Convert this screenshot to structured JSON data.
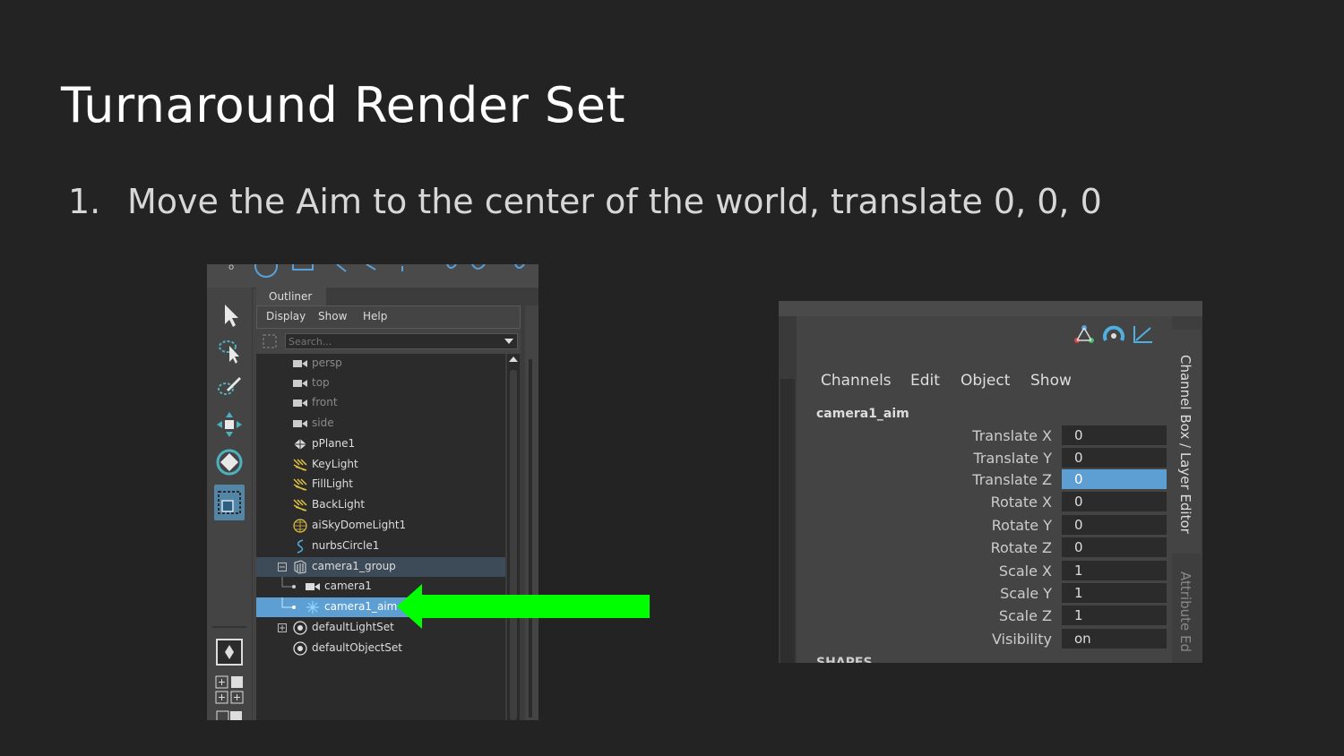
{
  "slide": {
    "title": "Turnaround Render Set",
    "step_number": "1.",
    "step_text": "Move the Aim to the center of the world, translate 0, 0, 0"
  },
  "outliner": {
    "panel_title": "Outliner",
    "menu": [
      "Display",
      "Show",
      "Help"
    ],
    "search_placeholder": "Search...",
    "items": [
      {
        "label": "persp",
        "icon": "camera-icon",
        "state": "dim"
      },
      {
        "label": "top",
        "icon": "camera-icon",
        "state": "dim"
      },
      {
        "label": "front",
        "icon": "camera-icon",
        "state": "dim"
      },
      {
        "label": "side",
        "icon": "camera-icon",
        "state": "dim"
      },
      {
        "label": "pPlane1",
        "icon": "mesh-icon",
        "state": "normal"
      },
      {
        "label": "KeyLight",
        "icon": "area-light-icon",
        "state": "normal"
      },
      {
        "label": "FillLight",
        "icon": "area-light-icon",
        "state": "normal"
      },
      {
        "label": "BackLight",
        "icon": "area-light-icon",
        "state": "normal"
      },
      {
        "label": "aiSkyDomeLight1",
        "icon": "sky-dome-icon",
        "state": "normal"
      },
      {
        "label": "nurbsCircle1",
        "icon": "curve-icon",
        "state": "normal"
      },
      {
        "label": "camera1_group",
        "icon": "group-icon",
        "state": "group",
        "expander": "minus"
      },
      {
        "label": "camera1",
        "icon": "camera-icon",
        "state": "child"
      },
      {
        "label": "camera1_aim",
        "icon": "locator-icon",
        "state": "selected"
      },
      {
        "label": "defaultLightSet",
        "icon": "set-icon",
        "state": "normal",
        "expander": "plus"
      },
      {
        "label": "defaultObjectSet",
        "icon": "set-icon",
        "state": "normal"
      }
    ],
    "pointer_color": "#00ff00"
  },
  "channel_box": {
    "menu": [
      "Channels",
      "Edit",
      "Object",
      "Show"
    ],
    "node_name": "camera1_aim",
    "attributes": [
      {
        "name": "Translate X",
        "value": "0"
      },
      {
        "name": "Translate Y",
        "value": "0"
      },
      {
        "name": "Translate Z",
        "value": "0",
        "highlight": true
      },
      {
        "name": "Rotate X",
        "value": "0"
      },
      {
        "name": "Rotate Y",
        "value": "0"
      },
      {
        "name": "Rotate Z",
        "value": "0"
      },
      {
        "name": "Scale X",
        "value": "1"
      },
      {
        "name": "Scale Y",
        "value": "1"
      },
      {
        "name": "Scale Z",
        "value": "1"
      },
      {
        "name": "Visibility",
        "value": "on"
      }
    ],
    "shapes_header": "SHAPES",
    "side_tab_active": "Channel Box / Layer Editor",
    "side_tab_inactive": "Attribute Ed",
    "highlight_color": "#5d9ed3"
  }
}
